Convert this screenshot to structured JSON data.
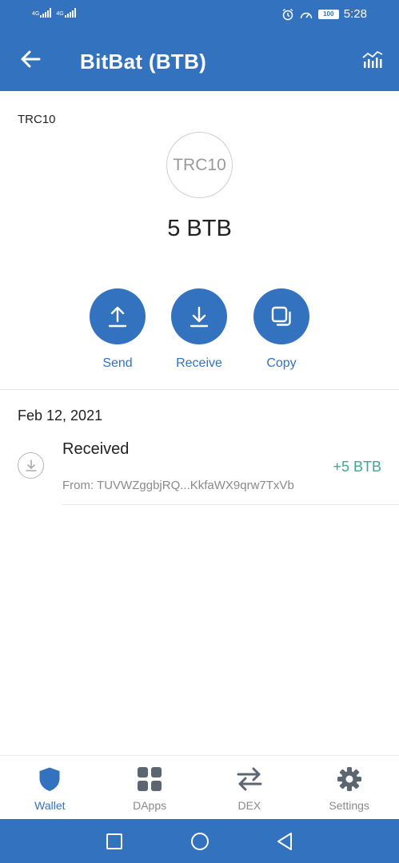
{
  "status_bar": {
    "network_1": "4G",
    "network_2": "4G",
    "battery": "100",
    "time": "5:28"
  },
  "app_bar": {
    "title": "BitBat (BTB)",
    "back_icon": "arrow-left-icon",
    "chart_icon": "bar-chart-icon"
  },
  "token": {
    "type_label": "TRC10",
    "logo_text": "TRC10",
    "balance": "5 BTB"
  },
  "actions": [
    {
      "label": "Send",
      "icon": "upload-icon"
    },
    {
      "label": "Receive",
      "icon": "download-icon"
    },
    {
      "label": "Copy",
      "icon": "copy-icon"
    }
  ],
  "transactions": {
    "date": "Feb 12, 2021",
    "items": [
      {
        "type": "Received",
        "from": "From: TUVWZggbjRQ...KkfaWX9qrw7TxVb",
        "amount": "+5 BTB"
      }
    ]
  },
  "bottom_nav": [
    {
      "label": "Wallet",
      "icon": "shield-icon",
      "active": true
    },
    {
      "label": "DApps",
      "icon": "grid-icon",
      "active": false
    },
    {
      "label": "DEX",
      "icon": "swap-arrows-icon",
      "active": false
    },
    {
      "label": "Settings",
      "icon": "gear-icon",
      "active": false
    }
  ],
  "colors": {
    "primary": "#3372bf",
    "positive": "#3fa88a",
    "muted": "#8a8a8a"
  }
}
